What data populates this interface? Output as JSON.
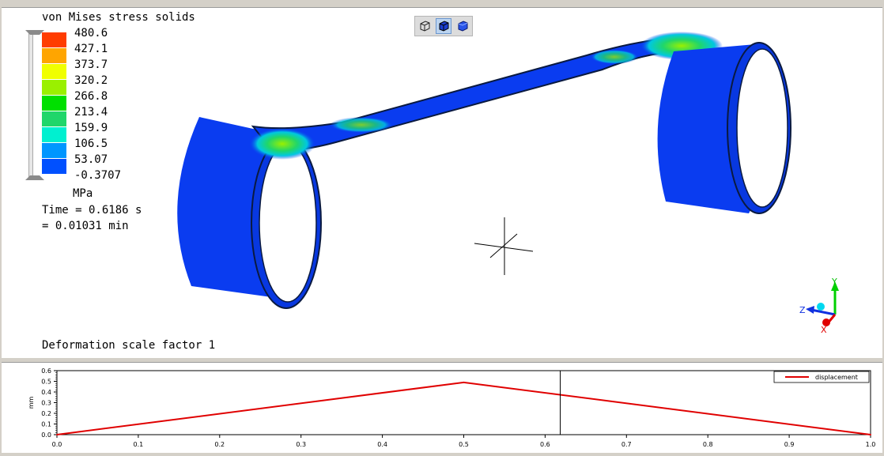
{
  "viewport": {
    "title": "von Mises stress solids",
    "legend": {
      "values": [
        "480.6",
        "427.1",
        "373.7",
        "320.2",
        "266.8",
        "213.4",
        "159.9",
        "106.5",
        "53.07",
        "-0.3707"
      ],
      "colors": [
        "#ff3c00",
        "#ffa500",
        "#f0ff00",
        "#9af000",
        "#00e000",
        "#20d66a",
        "#00f0d0",
        "#0096ff",
        "#0050ff"
      ],
      "units": "MPa"
    },
    "time_seconds": "Time = 0.6186 s",
    "time_minutes": "= 0.01031 min",
    "deformation": "Deformation scale factor 1",
    "toolbar": [
      "view-front-icon",
      "view-solid-icon",
      "view-shaded-icon"
    ],
    "triad": {
      "y": "Y",
      "z": "Z",
      "x": "X"
    },
    "part_color": "#0a3cf0"
  },
  "chart_data": {
    "type": "line",
    "x": [
      0.0,
      0.5,
      1.0
    ],
    "series": [
      {
        "name": "displacement",
        "values": [
          0.0,
          0.49,
          0.0
        ],
        "color": "#e00000"
      }
    ],
    "xlim": [
      0.0,
      1.0
    ],
    "ylim": [
      0.0,
      0.6
    ],
    "xticks": [
      "0.0",
      "0.1",
      "0.2",
      "0.3",
      "0.4",
      "0.5",
      "0.6",
      "0.7",
      "0.8",
      "0.9",
      "1.0"
    ],
    "yticks": [
      "0.0",
      "0.1",
      "0.2",
      "0.3",
      "0.4",
      "0.5",
      "0.6"
    ],
    "ylabel": "mm",
    "cursor_x": 0.6186,
    "legend_position": "top-right"
  }
}
